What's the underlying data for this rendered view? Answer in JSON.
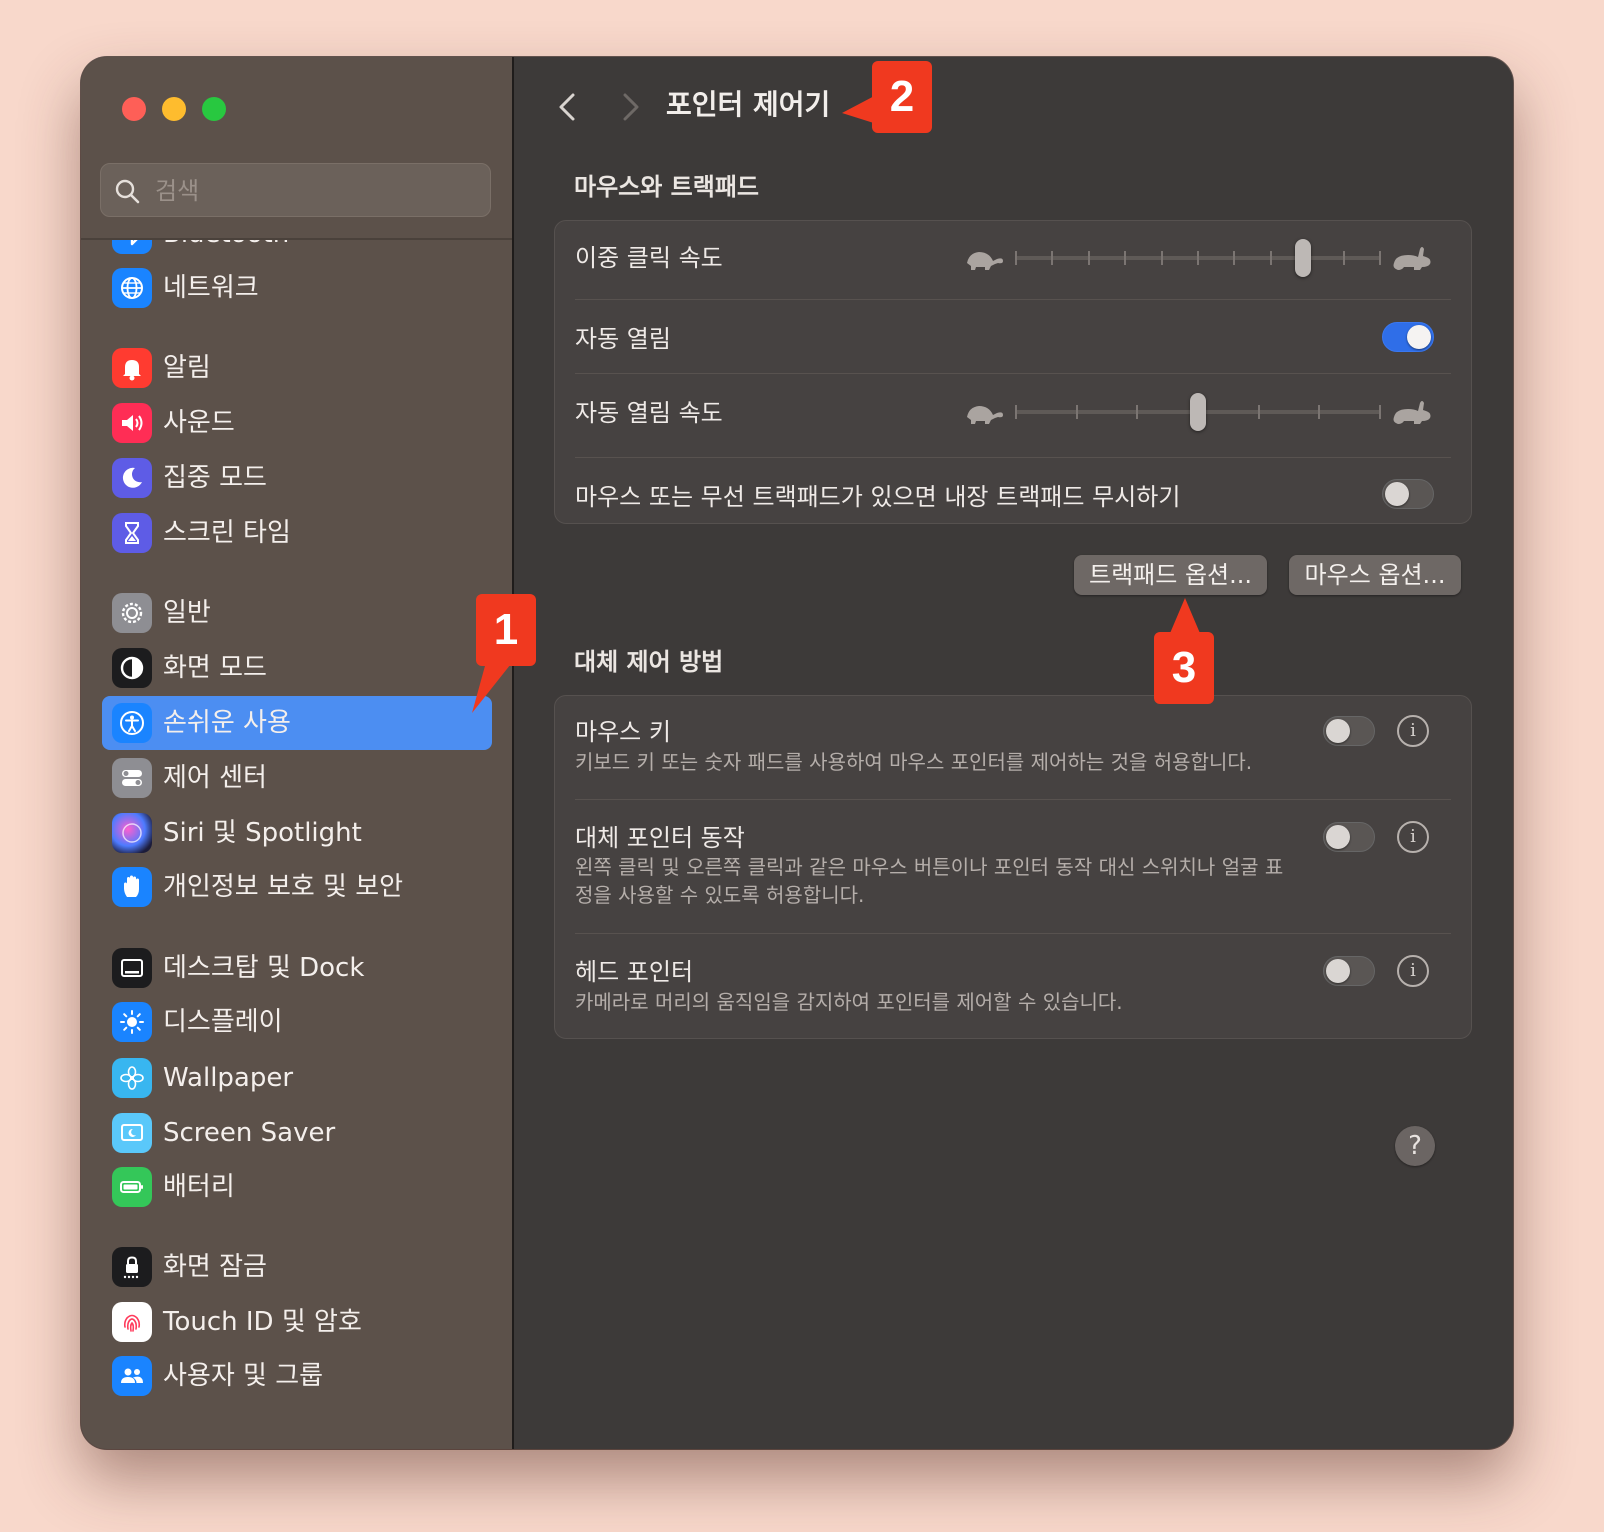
{
  "search": {
    "placeholder": "검색"
  },
  "sidebar": {
    "items": [
      {
        "label": "Bluetooth",
        "icon": "bluetooth-icon",
        "color": "#1a84ff"
      },
      {
        "label": "네트워크",
        "icon": "globe-icon",
        "color": "#1a84ff"
      },
      {
        "label": "알림",
        "icon": "bell-icon",
        "color": "#ff3b30"
      },
      {
        "label": "사운드",
        "icon": "speaker-icon",
        "color": "#ff2d55"
      },
      {
        "label": "집중 모드",
        "icon": "moon-icon",
        "color": "#5e5ce6"
      },
      {
        "label": "스크린 타임",
        "icon": "hourglass-icon",
        "color": "#5e5ce6"
      },
      {
        "label": "일반",
        "icon": "gear-icon",
        "color": "#8e8e93"
      },
      {
        "label": "화면 모드",
        "icon": "appearance-icon",
        "color": "#1c1c1e"
      },
      {
        "label": "손쉬운 사용",
        "icon": "accessibility-icon",
        "color": "#1a84ff"
      },
      {
        "label": "제어 센터",
        "icon": "switches-icon",
        "color": "#8e8e93"
      },
      {
        "label": "Siri 및 Spotlight",
        "icon": "siri-icon",
        "color": "#2b2b6e"
      },
      {
        "label": "개인정보 보호 및 보안",
        "icon": "hand-icon",
        "color": "#1a84ff"
      },
      {
        "label": "데스크탑 및 Dock",
        "icon": "dock-icon",
        "color": "#1c1c1e"
      },
      {
        "label": "디스플레이",
        "icon": "sun-icon",
        "color": "#1a84ff"
      },
      {
        "label": "Wallpaper",
        "icon": "flower-icon",
        "color": "#38b6f0"
      },
      {
        "label": "Screen Saver",
        "icon": "screensaver-icon",
        "color": "#5ac8fa"
      },
      {
        "label": "배터리",
        "icon": "battery-icon",
        "color": "#34c759"
      },
      {
        "label": "화면 잠금",
        "icon": "lock-icon",
        "color": "#1c1c1e"
      },
      {
        "label": "Touch ID 및 암호",
        "icon": "fingerprint-icon",
        "color": "#ffffff"
      },
      {
        "label": "사용자 및 그룹",
        "icon": "users-icon",
        "color": "#1a84ff"
      }
    ],
    "selected": "손쉬운 사용"
  },
  "main": {
    "title": "포인터 제어기",
    "section1": {
      "title": "마우스와 트랙패드",
      "double_click_speed": {
        "label": "이중 클릭 속도",
        "value_fraction": 0.8
      },
      "spring_loading": {
        "label": "자동 열림",
        "on": true
      },
      "spring_loading_speed": {
        "label": "자동 열림 속도",
        "value_fraction": 0.5
      },
      "ignore_trackpad": {
        "label": "마우스 또는 무선 트랙패드가 있으면 내장 트랙패드 무시하기",
        "on": false
      }
    },
    "buttons": {
      "trackpad_options": "트랙패드 옵션...",
      "mouse_options": "마우스 옵션..."
    },
    "section2": {
      "title": "대체 제어 방법",
      "mouse_keys": {
        "label": "마우스 키",
        "desc": "키보드 키 또는 숫자 패드를 사용하여 마우스 포인터를 제어하는 것을 허용합니다.",
        "on": false
      },
      "alt_pointer": {
        "label": "대체 포인터 동작",
        "desc": "왼쪽 클릭 및 오른쪽 클릭과 같은 마우스 버튼이나 포인터 동작 대신 스위치나 얼굴 표정을 사용할 수 있도록 허용합니다.",
        "on": false
      },
      "head_pointer": {
        "label": "헤드 포인터",
        "desc": "카메라로 머리의 움직임을 감지하여 포인터를 제어할 수 있습니다.",
        "on": false
      }
    },
    "help": "?"
  },
  "annotations": {
    "badge1": "1",
    "badge2": "2",
    "badge3": "3",
    "color": "#f0391f"
  }
}
